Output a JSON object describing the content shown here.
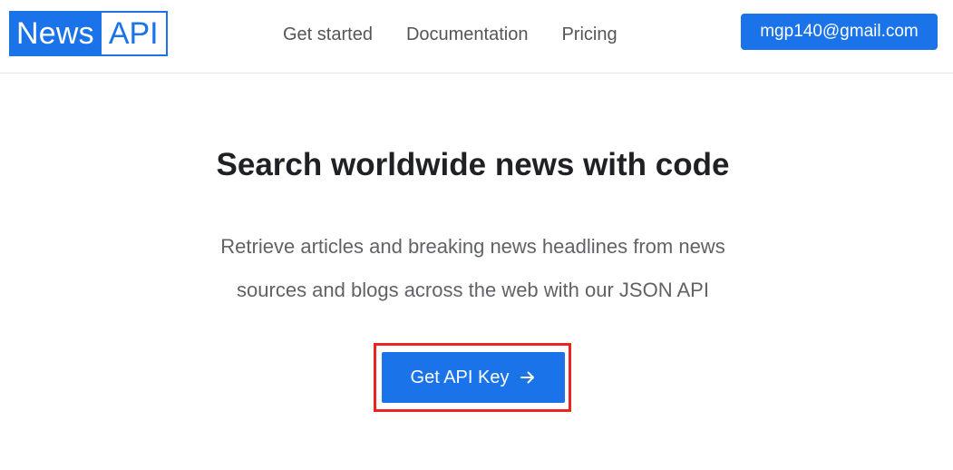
{
  "logo": {
    "part1": "News",
    "part2": "API"
  },
  "nav": {
    "items": [
      {
        "label": "Get started"
      },
      {
        "label": "Documentation"
      },
      {
        "label": "Pricing"
      }
    ]
  },
  "account": {
    "email": "mgp140@gmail.com"
  },
  "hero": {
    "title": "Search worldwide news with code",
    "description_line1": "Retrieve articles and breaking news headlines from news",
    "description_line2": "sources and blogs across the web with our JSON API",
    "cta_label": "Get API Key",
    "cta_icon": "arrow-right-icon"
  },
  "colors": {
    "brand": "#1a73e8",
    "highlight": "#e8261f"
  }
}
